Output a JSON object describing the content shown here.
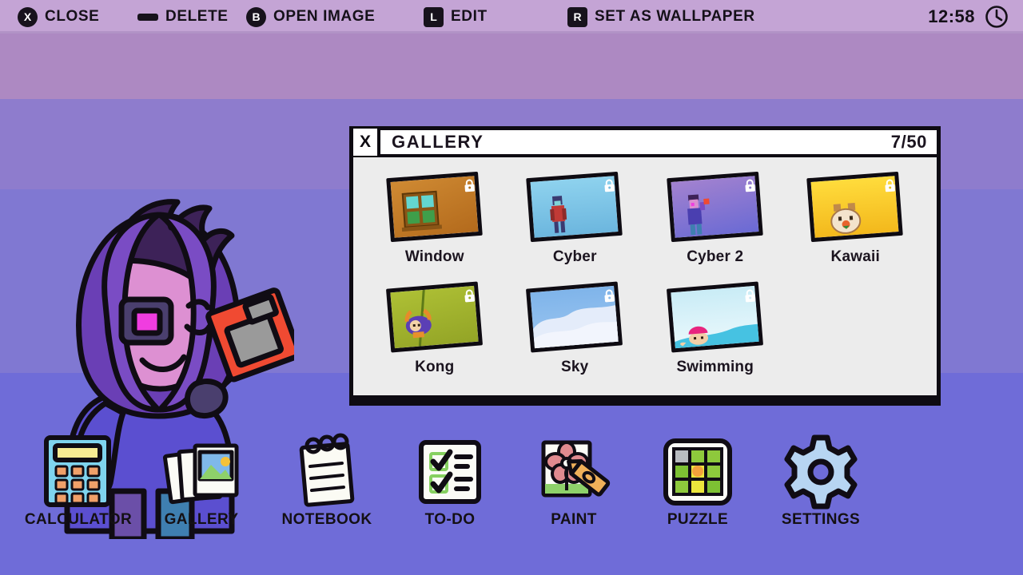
{
  "topbar": {
    "actions": [
      {
        "key": "X",
        "key_shape": "round",
        "label": "CLOSE"
      },
      {
        "key": "",
        "key_shape": "bar",
        "label": "DELETE"
      },
      {
        "key": "B",
        "key_shape": "round",
        "label": "OPEN IMAGE"
      },
      {
        "key": "L",
        "key_shape": "square",
        "label": "EDIT"
      },
      {
        "key": "R",
        "key_shape": "square",
        "label": "SET AS WALLPAPER"
      }
    ],
    "time": "12:58",
    "clock_icon": "clock-icon",
    "bg_color": "#c4a4d5"
  },
  "window": {
    "close_label": "X",
    "title": "GALLERY",
    "counter": "7/50",
    "body_bg": "#ececec",
    "items": [
      {
        "name": "Window",
        "locked": true,
        "lock_icon": "lock-icon",
        "bg": "#c07c28"
      },
      {
        "name": "Cyber",
        "locked": true,
        "lock_icon": "lock-icon",
        "bg": "#7cc4e4"
      },
      {
        "name": "Cyber 2",
        "locked": true,
        "lock_icon": "lock-icon",
        "bg": "#9b7fc9"
      },
      {
        "name": "Kawaii",
        "locked": true,
        "lock_icon": "lock-icon",
        "bg": "#fcd320"
      },
      {
        "name": "Kong",
        "locked": true,
        "lock_icon": "lock-icon",
        "bg": "#a3b432"
      },
      {
        "name": "Sky",
        "locked": true,
        "lock_icon": "lock-icon",
        "bg": "#7fb4ea"
      },
      {
        "name": "Swimming",
        "locked": true,
        "lock_icon": "lock-icon",
        "bg": "#bfe9f4"
      }
    ]
  },
  "dock": {
    "items": [
      {
        "label": "CALCULATOR",
        "icon": "calculator-icon"
      },
      {
        "label": "GALLERY",
        "icon": "photos-icon"
      },
      {
        "label": "NOTEBOOK",
        "icon": "notepad-icon"
      },
      {
        "label": "TO-DO",
        "icon": "checklist-icon"
      },
      {
        "label": "PAINT",
        "icon": "paint-icon"
      },
      {
        "label": "PUZZLE",
        "icon": "puzzle-icon"
      },
      {
        "label": "SETTINGS",
        "icon": "gear-icon"
      }
    ]
  },
  "desktop": {
    "mascot_icon": "mascot-character",
    "band_colors": [
      "#ad89c2",
      "#8e7ccd",
      "#8078d2",
      "#6f6cd8"
    ]
  }
}
